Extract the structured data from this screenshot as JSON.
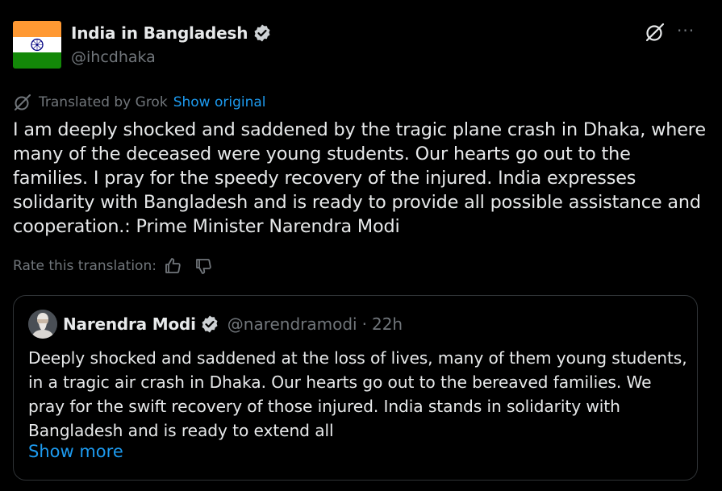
{
  "post": {
    "author": {
      "name": "India in Bangladesh",
      "handle": "@ihcdhaka",
      "avatar_icon": "india-flag",
      "verified": true
    },
    "header_actions": {
      "grok_icon": "grok-icon",
      "more_icon": "more-icon",
      "more_label": "···"
    },
    "translation": {
      "label": "Translated by Grok",
      "show_original": "Show original",
      "rate_label": "Rate this translation:"
    },
    "text": "I am deeply shocked and saddened by the tragic plane crash in Dhaka, where many of the deceased were young students. Our hearts go out to the families. I pray for the speedy recovery of the injured. India expresses solidarity with Bangladesh and is ready to provide all possible assistance and cooperation.: Prime Minister Narendra Modi",
    "quote": {
      "name": "Narendra Modi",
      "handle": "@narendramodi",
      "separator": "·",
      "time": "22h",
      "verified": true,
      "text": "Deeply shocked and saddened at the loss of lives, many of them young students, in a tragic air crash in Dhaka. Our hearts go out to the bereaved families. We pray for the swift recovery of those injured. India stands in solidarity with Bangladesh and is ready to extend all",
      "show_more": "Show more"
    }
  },
  "colors": {
    "background": "#000000",
    "text_primary": "#e7e9ea",
    "text_secondary": "#71767b",
    "accent": "#1d9bf0",
    "border": "#2f3336",
    "saffron": "#ff9933",
    "green": "#138808",
    "chakra": "#000080"
  }
}
